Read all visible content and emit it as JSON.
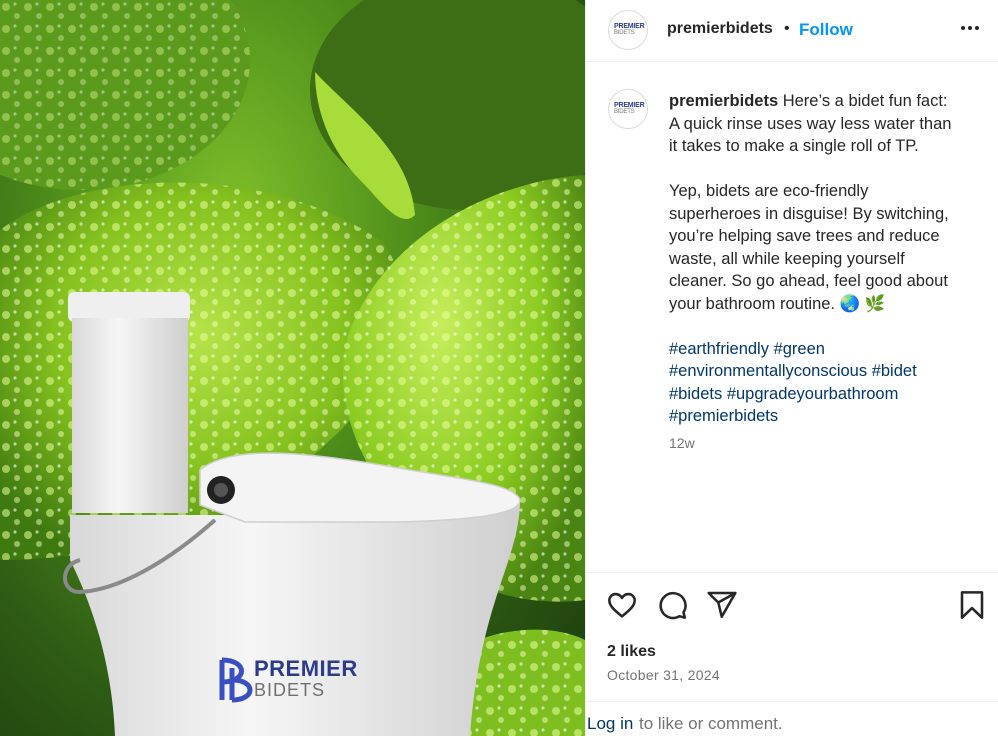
{
  "post": {
    "username": "premierbidets",
    "separator": "•",
    "follow_label": "Follow",
    "avatar_text_1": "PREMIER",
    "avatar_text_2": "BIDETS",
    "caption": {
      "line1": "Here’s a bidet fun fact:",
      "line2": "A quick rinse uses way less water than",
      "line3": "it takes to make a single roll of TP.",
      "line4": "Yep, bidets are eco-friendly",
      "line5": "superheroes in disguise! By switching,",
      "line6": "you’re helping save trees and reduce",
      "line7": "waste, all while keeping yourself",
      "line8": "cleaner. So go ahead, feel good about",
      "line9": "your bathroom routine. 🌏 🌿"
    },
    "hashtags": [
      "#earthfriendly",
      "#green",
      "#environmentallyconscious",
      "#bidet",
      "#bidets",
      "#upgradeyourbathroom",
      "#premierbidets"
    ],
    "age": "12w",
    "likes": "2 likes",
    "date": "October 31, 2024"
  },
  "image_brand": {
    "line1": "PREMIER",
    "line2": "BIDETS"
  },
  "login": {
    "link": "Log in",
    "rest": "to like or comment."
  },
  "icons": [
    "more-icon",
    "heart-icon",
    "comment-icon",
    "share-icon",
    "bookmark-icon"
  ],
  "colors": {
    "follow": "#0095f6",
    "hashtag": "#00376b",
    "muted": "#737373",
    "brand": "#2d3b8c"
  }
}
